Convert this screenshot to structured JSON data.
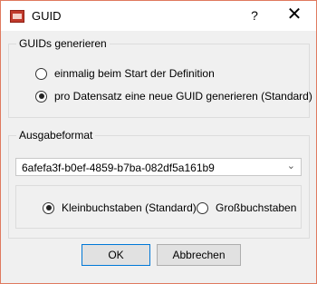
{
  "window": {
    "title": "GUID",
    "help_label": "?",
    "close_label": "✕"
  },
  "group_generate": {
    "legend": "GUIDs generieren",
    "options": [
      {
        "label": "einmalig beim Start der Definition",
        "checked": false
      },
      {
        "label": "pro Datensatz eine neue GUID generieren (Standard)",
        "checked": true
      }
    ]
  },
  "group_output": {
    "legend": "Ausgabeformat",
    "combo_value": "6afefa3f-b0ef-4859-b7ba-082df5a161b9",
    "case_options": [
      {
        "label": "Kleinbuchstaben (Standard)",
        "checked": true
      },
      {
        "label": "Großbuchstaben",
        "checked": false
      }
    ]
  },
  "buttons": {
    "ok": "OK",
    "cancel": "Abbrechen"
  }
}
